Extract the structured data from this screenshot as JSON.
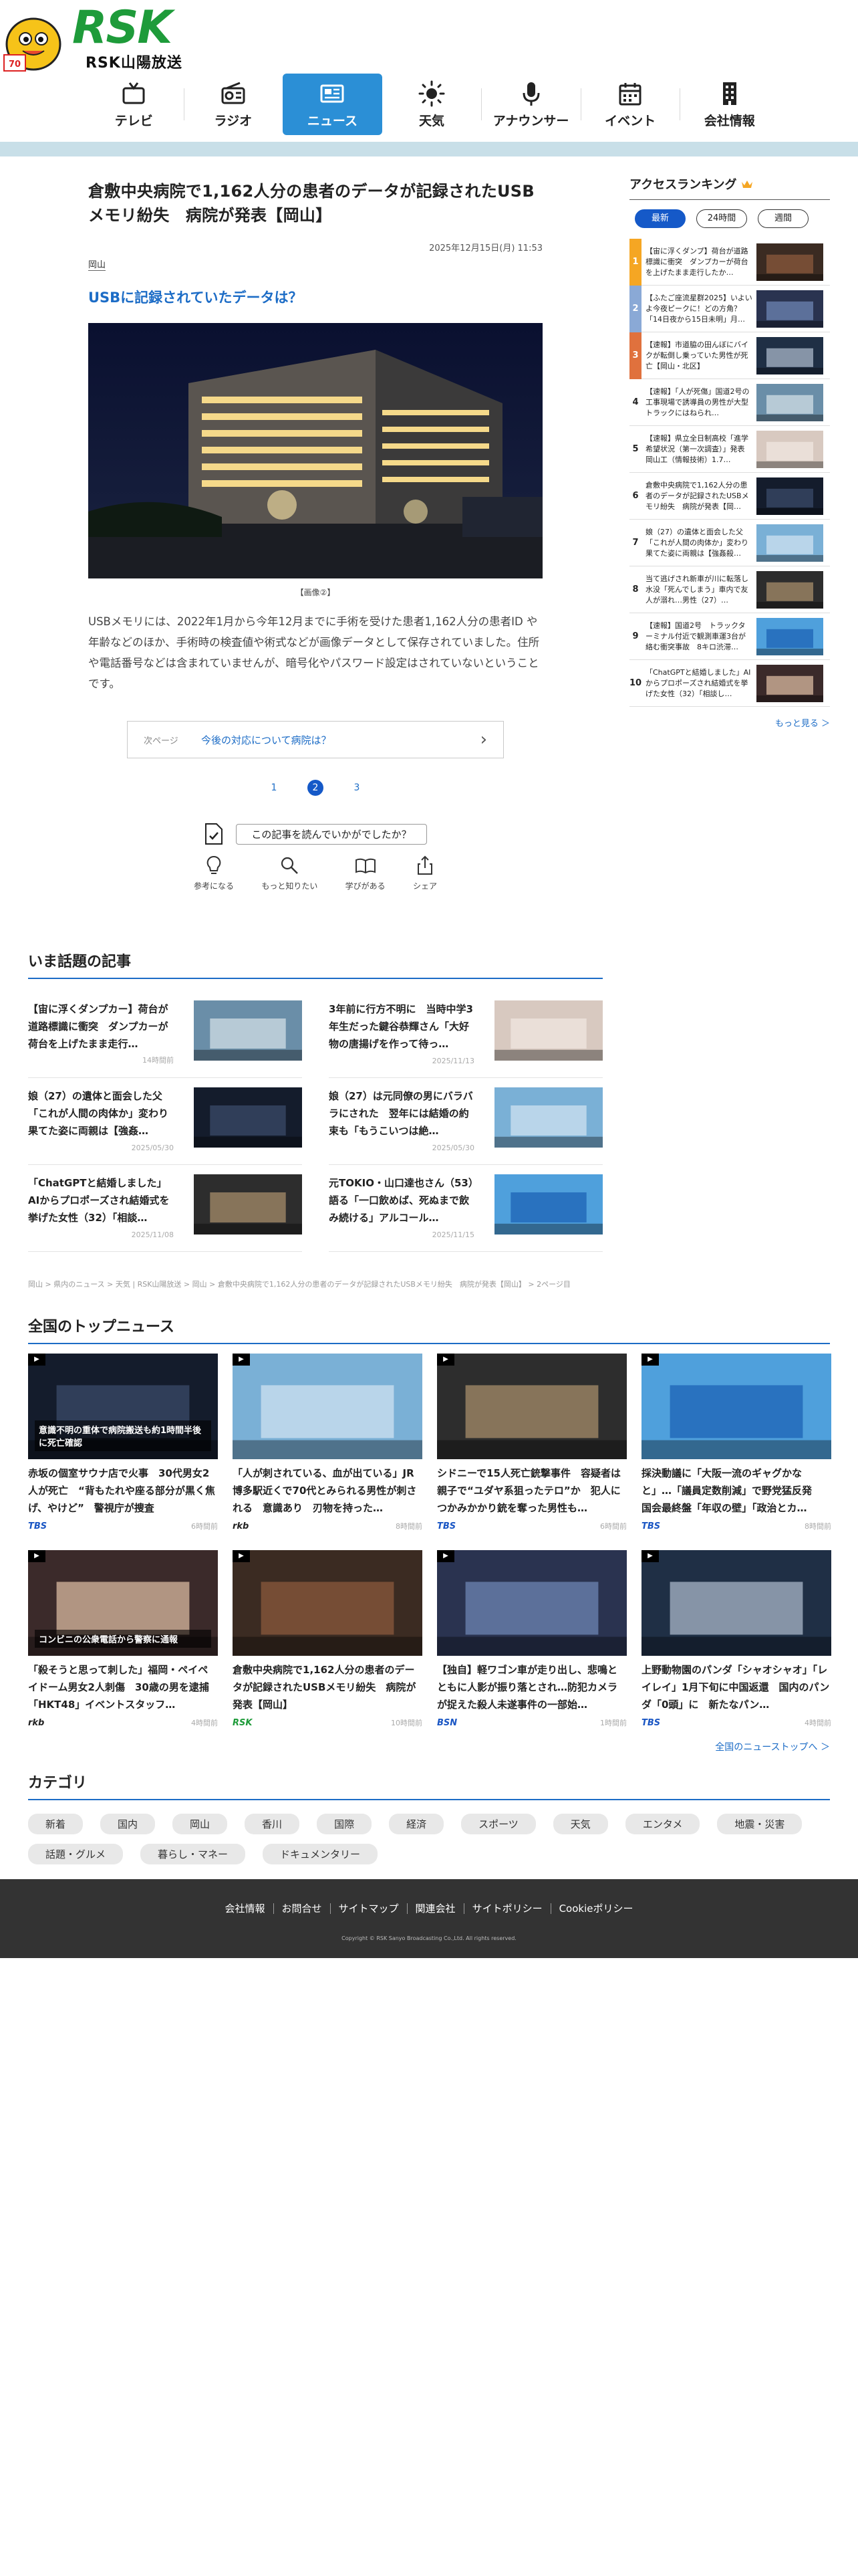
{
  "header": {
    "logo_text": "RSK",
    "logo_name": "RSK山陽放送",
    "nav": [
      {
        "label": "テレビ",
        "icon": "tv-icon"
      },
      {
        "label": "ラジオ",
        "icon": "radio-icon"
      },
      {
        "label": "ニュース",
        "icon": "news-icon",
        "active": true
      },
      {
        "label": "天気",
        "icon": "sun-icon"
      },
      {
        "label": "アナウンサー",
        "icon": "microphone-icon"
      },
      {
        "label": "イベント",
        "icon": "calendar-icon"
      },
      {
        "label": "会社情報",
        "icon": "building-icon"
      }
    ],
    "colors": {
      "logo_green": "#1e9b3a",
      "nav_active": "#2b8fd6",
      "band": "#c8dfe8"
    }
  },
  "article": {
    "title": "倉敷中央病院で1,162人分の患者のデータが記録されたUSBメモリ紛失　病院が発表【岡山】",
    "date": "2025年12月15日(月) 11:53",
    "tag": "岡山",
    "subheading": "USBに記録されていたデータは？",
    "caption": "【画像②】",
    "body": "USBメモリには、2022年1月から今年12月までに手術を受けた患者1,162人分の患者ID や年齢などのほか、手術時の検査値や術式などが画像データとして保存されていました。住所や電話番号などは含まれていませんが、暗号化やパスワード設定はされていないということです。",
    "next_label": "次ページ",
    "next_text": "今後の対応について病院は？",
    "pages": [
      "1",
      "2",
      "3"
    ],
    "current_page": 2,
    "survey_question": "この記事を読んでいかがでしたか？",
    "survey_options": [
      {
        "label": "参考になる",
        "icon": "lightbulb-icon"
      },
      {
        "label": "もっと知りたい",
        "icon": "magnifier-icon"
      },
      {
        "label": "学びがある",
        "icon": "book-icon"
      },
      {
        "label": "シェア",
        "icon": "share-icon"
      }
    ]
  },
  "ranking": {
    "title": "アクセスランキング",
    "tabs": [
      "最新",
      "24時間",
      "週間"
    ],
    "selected_tab": "最新",
    "items": [
      {
        "rank": "1",
        "title": "【宙に浮くダンプ】荷台が道路標識に衝突　ダンプカーが荷台を上げたまま走行したか…",
        "color": "#f5a623"
      },
      {
        "rank": "2",
        "title": "【ふたご座流星群2025】いよいよ今夜ピークに！どの方角？「14日夜から15日未明」月…",
        "color": "#8aa9d6"
      },
      {
        "rank": "3",
        "title": "【速報】市道脇の田んぼにバイクが転倒し乗っていた男性が死亡【岡山・北区】",
        "color": "#e0713d"
      },
      {
        "rank": "4",
        "title": "【速報】「人が死傷」国道2号の工事現場で誘導員の男性が大型トラックにはねられ…"
      },
      {
        "rank": "5",
        "title": "【速報】県立全日制高校「進学希望状況（第一次調査）」発表　岡山工（情報技術）1.7…"
      },
      {
        "rank": "6",
        "title": "倉敷中央病院で1,162人分の患者のデータが記録されたUSBメモリ紛失　病院が発表【岡…"
      },
      {
        "rank": "7",
        "title": "娘（27）の遺体と面会した父「これが人間の肉体か」変わり果てた姿に両親は【強姦殺…"
      },
      {
        "rank": "8",
        "title": "当て逃げされ新車が川に転落し水没「死んでしまう」車内で友人が溺れ…男性（27）…"
      },
      {
        "rank": "9",
        "title": "【速報】国道2号　トラックターミナル付近で観測車運3台が絡む衝突事故　8キロ渋滞…"
      },
      {
        "rank": "10",
        "title": "「ChatGPTと結婚しました」AIからプロポーズされ結婚式を挙げた女性（32）「相談し…"
      }
    ],
    "more": "もっと見る ＞"
  },
  "topics": {
    "title": "いま話題の記事",
    "items": [
      {
        "title": "【宙に浮くダンプカー】荷台が道路標識に衝突　ダンプカーが荷台を上げたまま走行…",
        "time": "14時間前"
      },
      {
        "title": "3年前に行方不明に　当時中学3年生だった鍵谷恭輝さん「大好物の唐揚げを作って待っ…",
        "time": "2025/11/13"
      },
      {
        "title": "娘（27）の遺体と面会した父「これが人間の肉体か」変わり果てた姿に両親は【強姦…",
        "time": "2025/05/30"
      },
      {
        "title": "娘（27）は元同僚の男にバラバラにされた　翌年には結婚の約束も「もうこいつは絶…",
        "time": "2025/05/30"
      },
      {
        "title": "「ChatGPTと結婚しました」AIからプロポーズされ結婚式を挙げた女性（32）「相談…",
        "time": "2025/11/08"
      },
      {
        "title": "元TOKIO・山口達也さん（53）語る「一口飲めば、死ぬまで飲み続ける」アルコール…",
        "time": "2025/11/15"
      }
    ],
    "breadcrumb": "岡山 > 県内のニュース > 天気 | RSK山陽放送 > 岡山 > 倉敷中央病院で1,162人分の患者のデータが記録されたUSBメモリ紛失　病院が発表【岡山】 > 2ページ目"
  },
  "national": {
    "title": "全国のトップニュース",
    "items": [
      {
        "title": "赤坂の個室サウナ店で火事　30代男女2人が死亡　“背もたれや座る部分が黒く焦げ、やけど”　警視庁が捜査",
        "source": "TBS",
        "time": "6時間前",
        "overlay": "意識不明の重体で病院搬送も約1時間半後に死亡確認"
      },
      {
        "title": "「人が刺されている、血が出ている」JR博多駅近くで70代とみられる男性が刺される　意識あり　刃物を持った…",
        "source": "rkb",
        "time": "8時間前",
        "overlay": ""
      },
      {
        "title": "シドニーで15人死亡銃撃事件　容疑者は親子で“ユダヤ系狙ったテロ”か　犯人につかみかかり銃を奪った男性も…",
        "source": "TBS",
        "time": "6時間前",
        "overlay": ""
      },
      {
        "title": "採決動議に「大阪一流のギャグかなと」…「議員定数削減」で野党猛反発　国会最終盤「年収の壁」「政治とカ…",
        "source": "TBS",
        "time": "8時間前",
        "overlay": ""
      },
      {
        "title": "「殺そうと思って刺した」福岡・ペイペイドーム男女2人刺傷　30歳の男を逮捕　「HKT48」イベントスタッフ…",
        "source": "rkb",
        "time": "4時間前",
        "overlay": "コンビニの公衆電話から警察に通報"
      },
      {
        "title": "倉敷中央病院で1,162人分の患者のデータが記録されたUSBメモリ紛失　病院が発表【岡山】",
        "source": "RSK",
        "time": "10時間前",
        "overlay": ""
      },
      {
        "title": "【独自】軽ワゴン車が走り出し、悲鳴とともに人影が振り落とされ…防犯カメラが捉えた殺人未遂事件の一部始…",
        "source": "BSN",
        "time": "1時間前",
        "overlay": ""
      },
      {
        "title": "上野動物園のパンダ「シャオシャオ」「レイレイ」1月下旬に中国返還　国内のパンダ「0頭」に　新たなパン…",
        "source": "TBS",
        "time": "4時間前",
        "overlay": ""
      }
    ],
    "more": "全国のニューストップへ ＞"
  },
  "categories": {
    "title": "カテゴリ",
    "items": [
      "新着",
      "国内",
      "岡山",
      "香川",
      "国際",
      "経済",
      "スポーツ",
      "天気",
      "エンタメ",
      "地震・災害",
      "話題・グルメ",
      "暮らし・マネー",
      "ドキュメンタリー"
    ]
  },
  "footer": {
    "links": [
      "会社情報",
      "お問合せ",
      "サイトマップ",
      "関連会社",
      "サイトポリシー",
      "Cookieポリシー"
    ],
    "copyright": "Copyright © RSK Sanyo Broadcasting Co.,Ltd. All rights reserved."
  }
}
